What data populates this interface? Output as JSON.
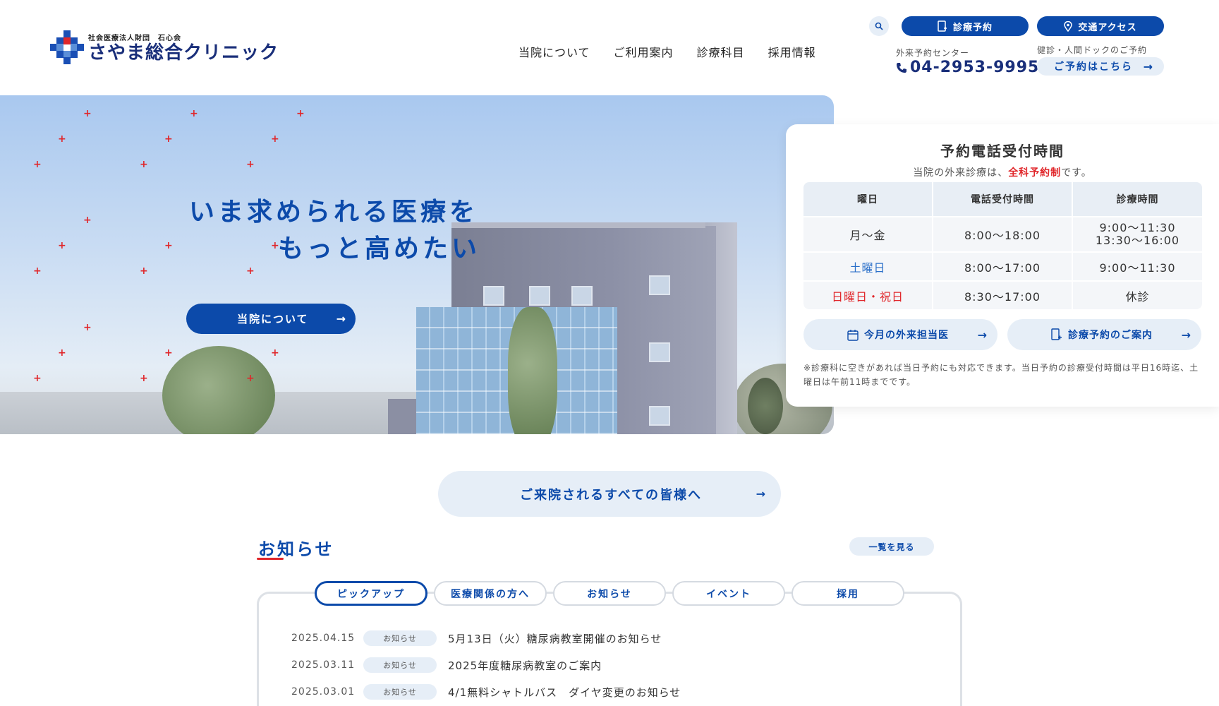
{
  "header": {
    "logo_sub": "社会医療法人財団　石心会",
    "logo_main": "さやま総合クリニック",
    "nav": [
      "当院について",
      "ご利用案内",
      "診療科目",
      "採用情報"
    ],
    "reserve_btn": "診療予約",
    "access_btn": "交通アクセス",
    "tel_label": "外来予約センター",
    "tel_number": "04-2953-9995",
    "dock_label": "健診・人間ドックのご予約",
    "dock_btn": "ご予約はこちら"
  },
  "hero": {
    "catch_line1": "いま求められる医療を",
    "catch_line2": "もっと高めたい",
    "about_btn": "当院について"
  },
  "hours": {
    "title": "予約電話受付時間",
    "note_prefix": "当院の外来診療は、",
    "note_highlight": "全科予約制",
    "note_suffix": "です。",
    "headers": [
      "曜日",
      "電話受付時間",
      "診療時間"
    ],
    "rows": [
      {
        "day": "月～金",
        "phone": "8:00～18:00",
        "clinic1": "9:00～11:30",
        "clinic2": "13:30～16:00"
      },
      {
        "day": "土曜日",
        "phone": "8:00～17:00",
        "clinic1": "9:00～11:30"
      },
      {
        "day": "日曜日・祝日",
        "phone": "8:30～17:00",
        "clinic1": "休診"
      }
    ],
    "btn_today": "今月の外来担当医",
    "btn_reserve": "診療予約のご案内",
    "footnote": "※診療科に空きがあれば当日予約にも対応できます。当日予約の診療受付時間は平日16時迄、土曜日は午前11時までです。"
  },
  "visitors_btn": "ご来院されるすべての皆様へ",
  "news": {
    "title": "お知らせ",
    "see_all": "一覧を見る",
    "tabs": [
      "ピックアップ",
      "医療関係の方へ",
      "お知らせ",
      "イベント",
      "採用"
    ],
    "items": [
      {
        "date": "2025.04.15",
        "cat": "お知らせ",
        "text": "5月13日（火）糖尿病教室開催のお知らせ"
      },
      {
        "date": "2025.03.11",
        "cat": "お知らせ",
        "text": "2025年度糖尿病教室のご案内"
      },
      {
        "date": "2025.03.01",
        "cat": "お知らせ",
        "text": "4/1無料シャトルバス　ダイヤ変更のお知らせ"
      }
    ]
  },
  "colors": {
    "brand": "#0c4aaa",
    "accent_red": "#e0262a",
    "light_blue": "#e6eef7"
  }
}
